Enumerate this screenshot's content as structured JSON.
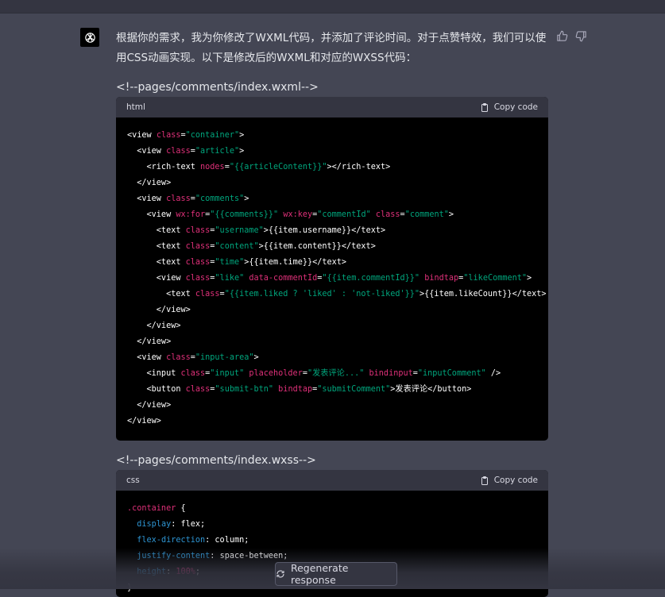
{
  "message": {
    "intro": "根据你的需求，我为你修改了WXML代码，并添加了评论时间。对于点赞特效，我们可以使用CSS动画实现。以下是修改后的WXML和对应的WXSS代码："
  },
  "block1": {
    "comment": "<!--pages/comments/index.wxml-->",
    "language": "html",
    "copy_label": "Copy code"
  },
  "block2": {
    "comment": "<!--pages/comments/index.wxss-->",
    "language": "css",
    "copy_label": "Copy code"
  },
  "regenerate_label": "Regenerate response",
  "icons": {
    "avatar": "openai-logo-icon",
    "thumbs_up": "thumbs-up-icon",
    "thumbs_down": "thumbs-down-icon",
    "copy": "clipboard-icon",
    "regenerate": "refresh-icon"
  },
  "colors": {
    "background": "#444654",
    "code_bg": "#000000",
    "code_header": "#343541",
    "attr": "#df3079",
    "string": "#00a67d",
    "property": "#2e95d3"
  }
}
